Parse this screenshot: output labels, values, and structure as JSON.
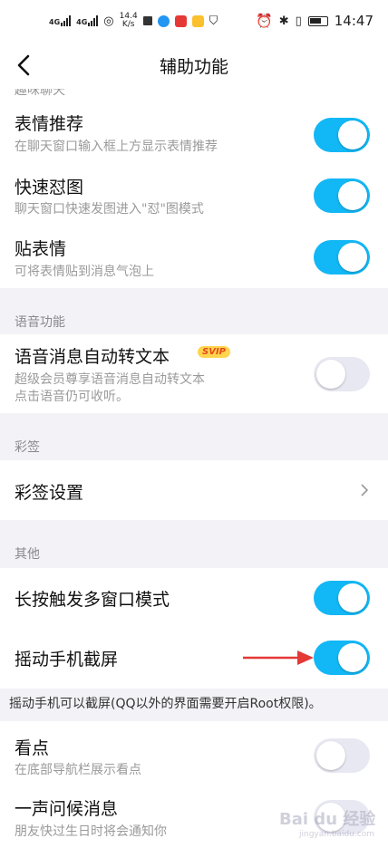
{
  "status_bar": {
    "signal_1": "4G",
    "signal_2": "4G",
    "speed_value": "14.4",
    "speed_unit": "K/s",
    "time": "14:47"
  },
  "nav": {
    "title": "辅助功能"
  },
  "partial_section_label": "趣味聊天",
  "items": {
    "emoji_recommend": {
      "title": "表情推荐",
      "subtitle": "在聊天窗口输入框上方显示表情推荐",
      "on": true
    },
    "quick_image": {
      "title": "快速怼图",
      "subtitle": "聊天窗口快速发图进入\"怼\"图模式",
      "on": true
    },
    "sticker": {
      "title": "贴表情",
      "subtitle": "可将表情贴到消息气泡上",
      "on": true
    },
    "voice_to_text": {
      "title": "语音消息自动转文本",
      "badge": "SVIP",
      "subtitle_1": "超级会员尊享语音消息自动转文本",
      "subtitle_2": "点击语音仍可收听。",
      "on": false
    },
    "signature_settings": {
      "title": "彩签设置"
    },
    "long_press_multiwindow": {
      "title": "长按触发多窗口模式",
      "on": true
    },
    "shake_screenshot": {
      "title": "摇动手机截屏",
      "on": true
    },
    "kandian": {
      "title": "看点",
      "subtitle": "在底部导航栏展示看点",
      "on": false
    },
    "greeting": {
      "title": "一声问候消息",
      "subtitle": "朋友快过生日时将会通知你",
      "on": false
    }
  },
  "sections": {
    "voice": "语音功能",
    "signature": "彩签",
    "other": "其他"
  },
  "shake_note": "摇动手机可以截屏(QQ以外的界面需要开启Root权限)。",
  "watermark": {
    "brand": "Bai du 经验",
    "url": "jingyan.baidu.com"
  },
  "colors": {
    "toggle_on": "#12b7f5",
    "toggle_off": "#e8e8f2",
    "annotation_arrow": "#e53935"
  }
}
